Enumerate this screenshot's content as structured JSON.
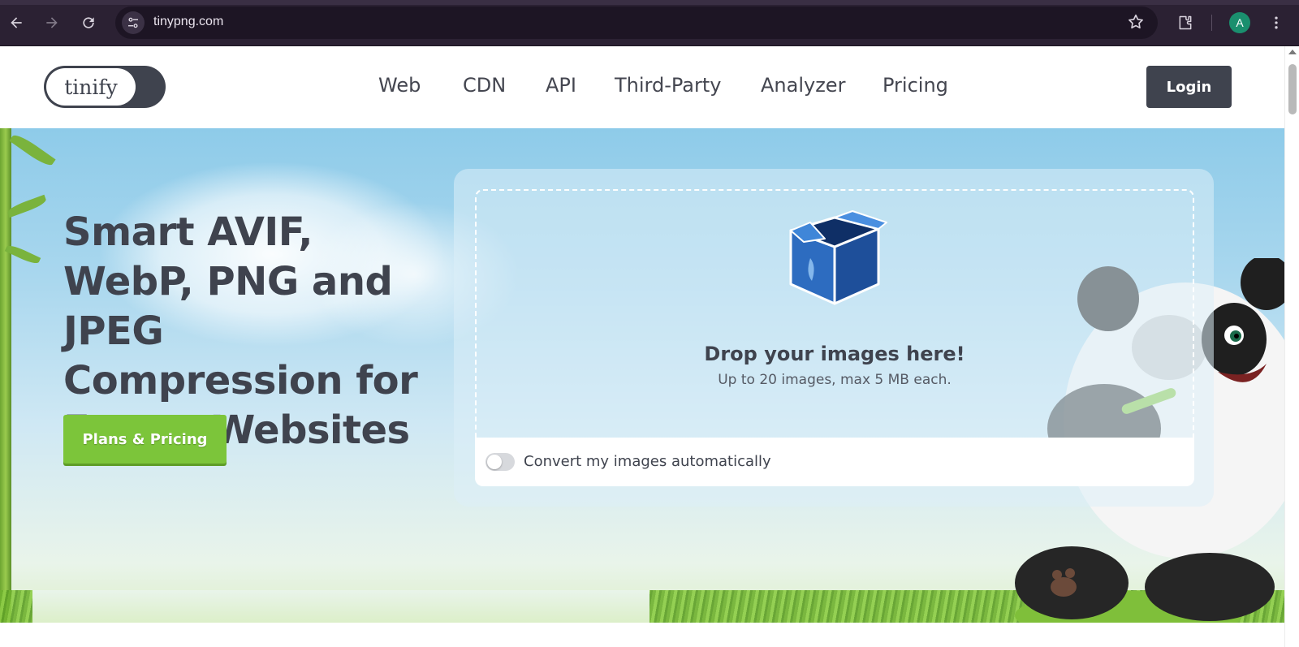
{
  "browser": {
    "url": "tinypng.com",
    "avatar_letter": "A",
    "icons": [
      "back-icon",
      "forward-icon",
      "reload-icon",
      "site-info-icon",
      "bookmark-star-icon",
      "extensions-icon",
      "menu-icon"
    ]
  },
  "header": {
    "logo_text": "tinify",
    "nav": [
      "Web",
      "CDN",
      "API",
      "Third-Party",
      "Analyzer",
      "Pricing"
    ],
    "login_label": "Login"
  },
  "hero": {
    "headline": "Smart AVIF, WebP, PNG and JPEG Compression for Faster Websites",
    "cta_label": "Plans & Pricing"
  },
  "dropzone": {
    "title": "Drop your images here!",
    "subtitle": "Up to 20 images, max 5 MB each.",
    "convert_label": "Convert my images automatically",
    "convert_enabled": false
  },
  "colors": {
    "brand_dark": "#3f434e",
    "cta_green": "#7cc53a",
    "sky": "#8ecbe9"
  }
}
